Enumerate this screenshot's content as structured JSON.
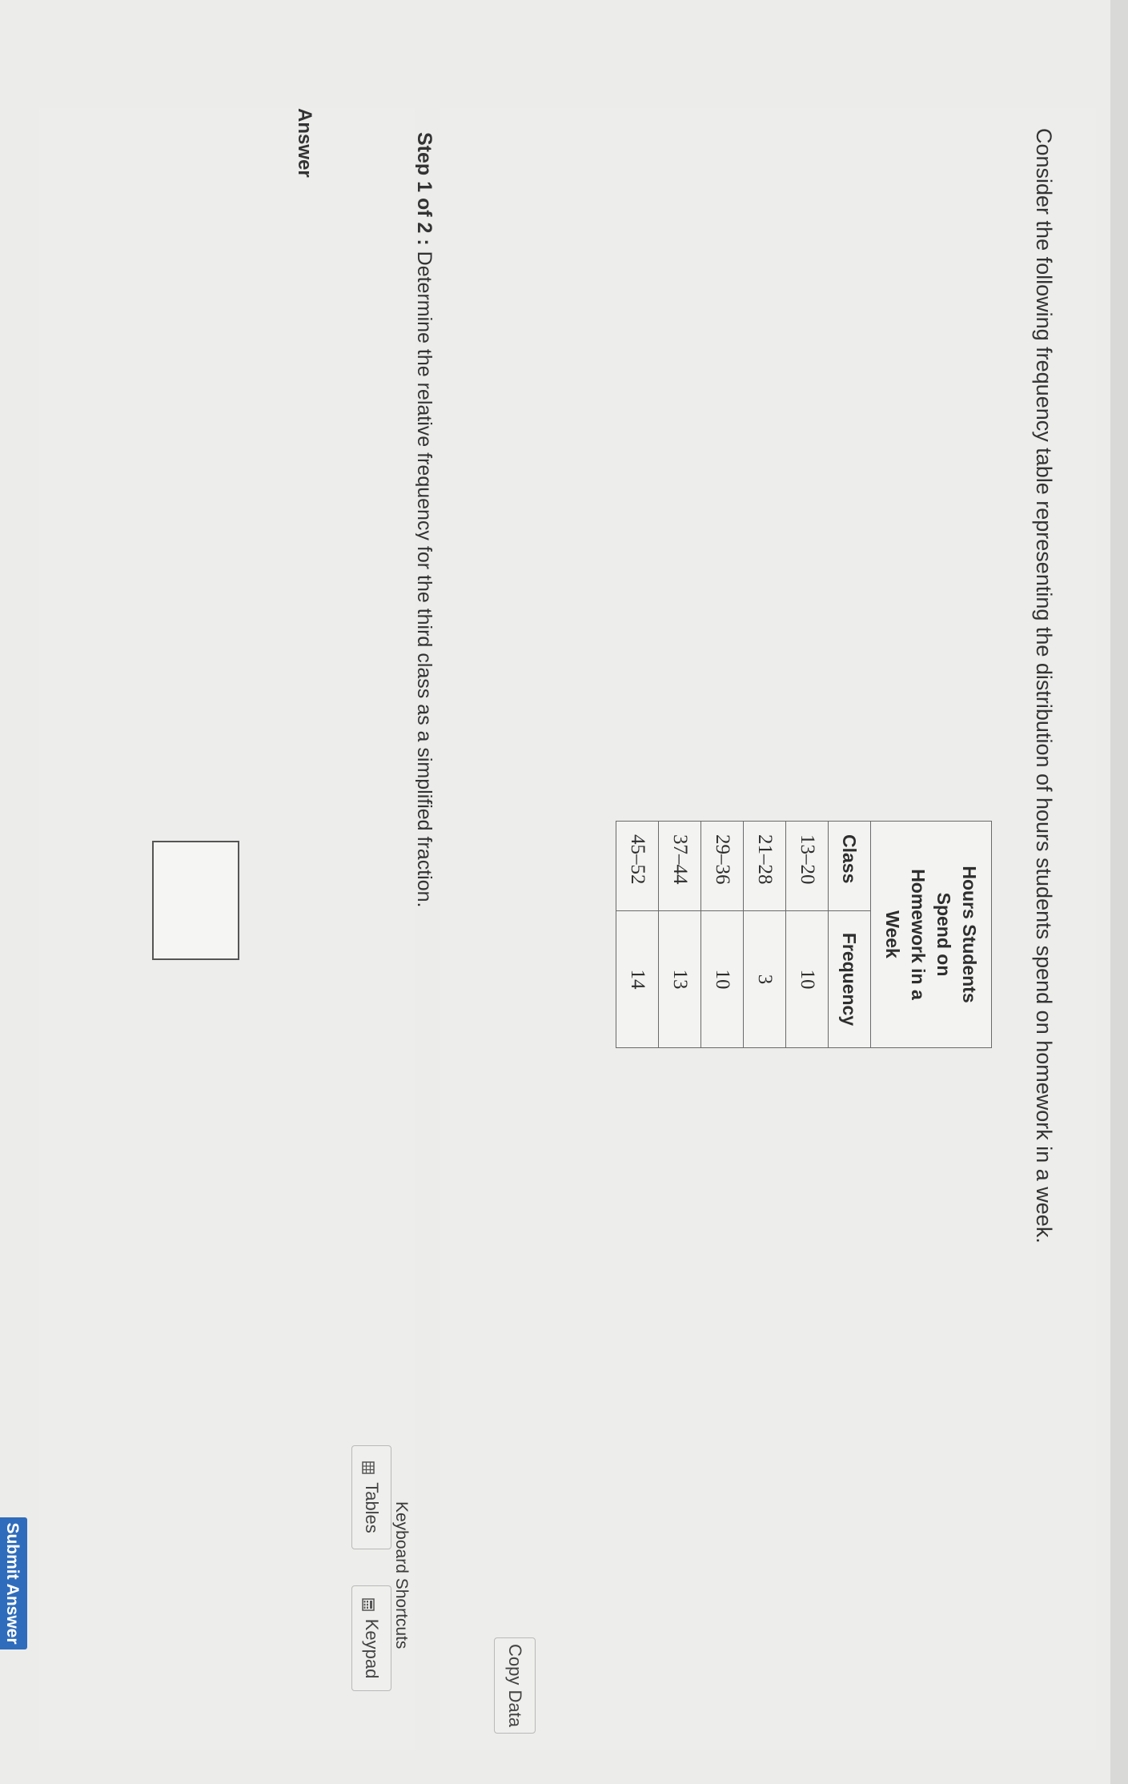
{
  "question": {
    "text": "Consider the following frequency table representing the distribution of hours students spend on homework in a week."
  },
  "table": {
    "caption": "Hours Students Spend on Homework in a Week",
    "caption_lines": [
      "Hours Students",
      "Spend on",
      "Homework in a",
      "Week"
    ],
    "headers": {
      "class": "Class",
      "frequency": "Frequency"
    },
    "rows": [
      {
        "class": "13–20",
        "frequency": "10"
      },
      {
        "class": "21–28",
        "frequency": "3"
      },
      {
        "class": "29–36",
        "frequency": "10"
      },
      {
        "class": "37–44",
        "frequency": "13"
      },
      {
        "class": "45–52",
        "frequency": "14"
      }
    ]
  },
  "buttons": {
    "copy_data": "Copy Data",
    "tables": "Tables",
    "keypad": "Keypad",
    "submit": "Submit Answer"
  },
  "links": {
    "keyboard_shortcuts": "Keyboard Shortcuts"
  },
  "step": {
    "label": "Step 1 of 2 :",
    "text": "Determine the relative frequency for the third class as a simplified fraction."
  },
  "answer": {
    "label": "Answer",
    "value": ""
  },
  "icons": {
    "tables": "table-grid-icon",
    "keypad": "keypad-icon"
  },
  "colors": {
    "submit_bg": "#2f6cbc",
    "page_bg": "#ececea"
  }
}
